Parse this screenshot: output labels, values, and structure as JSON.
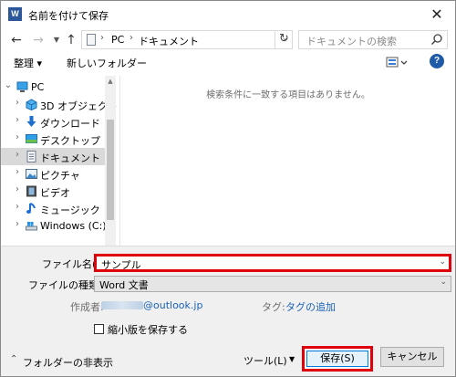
{
  "window": {
    "title": "名前を付けて保存",
    "app_icon_letter": "W",
    "close_glyph": "✕"
  },
  "nav": {
    "address": {
      "pc": "PC",
      "folder": "ドキュメント",
      "separator": "›"
    },
    "search_placeholder": "ドキュメントの検索"
  },
  "toolbar": {
    "organize": "整理 ▾",
    "new_folder": "新しいフォルダー",
    "help": "?"
  },
  "tree": {
    "items": [
      {
        "label": "PC",
        "icon": "pc-icon"
      },
      {
        "label": "3D オブジェクト",
        "icon": "3d-objects-icon"
      },
      {
        "label": "ダウンロード",
        "icon": "download-icon"
      },
      {
        "label": "デスクトップ",
        "icon": "desktop-icon"
      },
      {
        "label": "ドキュメント",
        "icon": "documents-icon",
        "selected": true
      },
      {
        "label": "ピクチャ",
        "icon": "pictures-icon"
      },
      {
        "label": "ビデオ",
        "icon": "videos-icon"
      },
      {
        "label": "ミュージック",
        "icon": "music-icon"
      },
      {
        "label": "Windows (C:)",
        "icon": "drive-icon"
      }
    ]
  },
  "content": {
    "empty_message": "検索条件に一致する項目はありません。"
  },
  "form": {
    "filename_label": "ファイル名(N):",
    "filename_value": "サンプル",
    "filetype_label": "ファイルの種類(T):",
    "filetype_value": "Word 文書",
    "author_label": "作成者:",
    "author_value": "@outlook.jp",
    "tags_label": "タグ:",
    "tags_link": "タグの追加",
    "thumbnail_label": "縮小版を保存する",
    "thumbnail_checked": false
  },
  "footer": {
    "hide_folders": "フォルダーの非表示",
    "tools": "ツール(L)",
    "save": "保存(S)",
    "cancel": "キャンセル"
  },
  "colors": {
    "highlight_red": "#e0000c",
    "link_blue": "#1a62b8",
    "word_blue": "#2b579a"
  }
}
